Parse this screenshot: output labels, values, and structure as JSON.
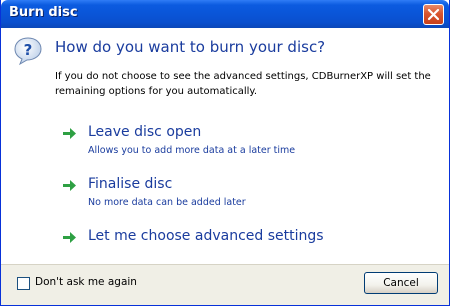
{
  "window": {
    "title": "Burn disc"
  },
  "header": {
    "icon": "question-balloon-icon",
    "heading": "How do you want to burn your disc?",
    "description": "If you do not choose to see the advanced settings, CDBurnerXP will set the remaining options for you automatically."
  },
  "options": [
    {
      "title": "Leave disc open",
      "subtitle": "Allows you to add more data at a later time",
      "icon": "green-arrow-icon"
    },
    {
      "title": "Finalise disc",
      "subtitle": "No more data can be added later",
      "icon": "green-arrow-icon"
    },
    {
      "title": "Let me choose advanced settings",
      "subtitle": "",
      "icon": "green-arrow-icon"
    }
  ],
  "footer": {
    "checkbox_label": "Don't ask me again",
    "checkbox_checked": false,
    "cancel_label": "Cancel"
  },
  "colors": {
    "titlebar": "#0a55d8",
    "link_text": "#1a3c9e",
    "arrow": "#2ea043",
    "footer_bg": "#f0efe6"
  }
}
